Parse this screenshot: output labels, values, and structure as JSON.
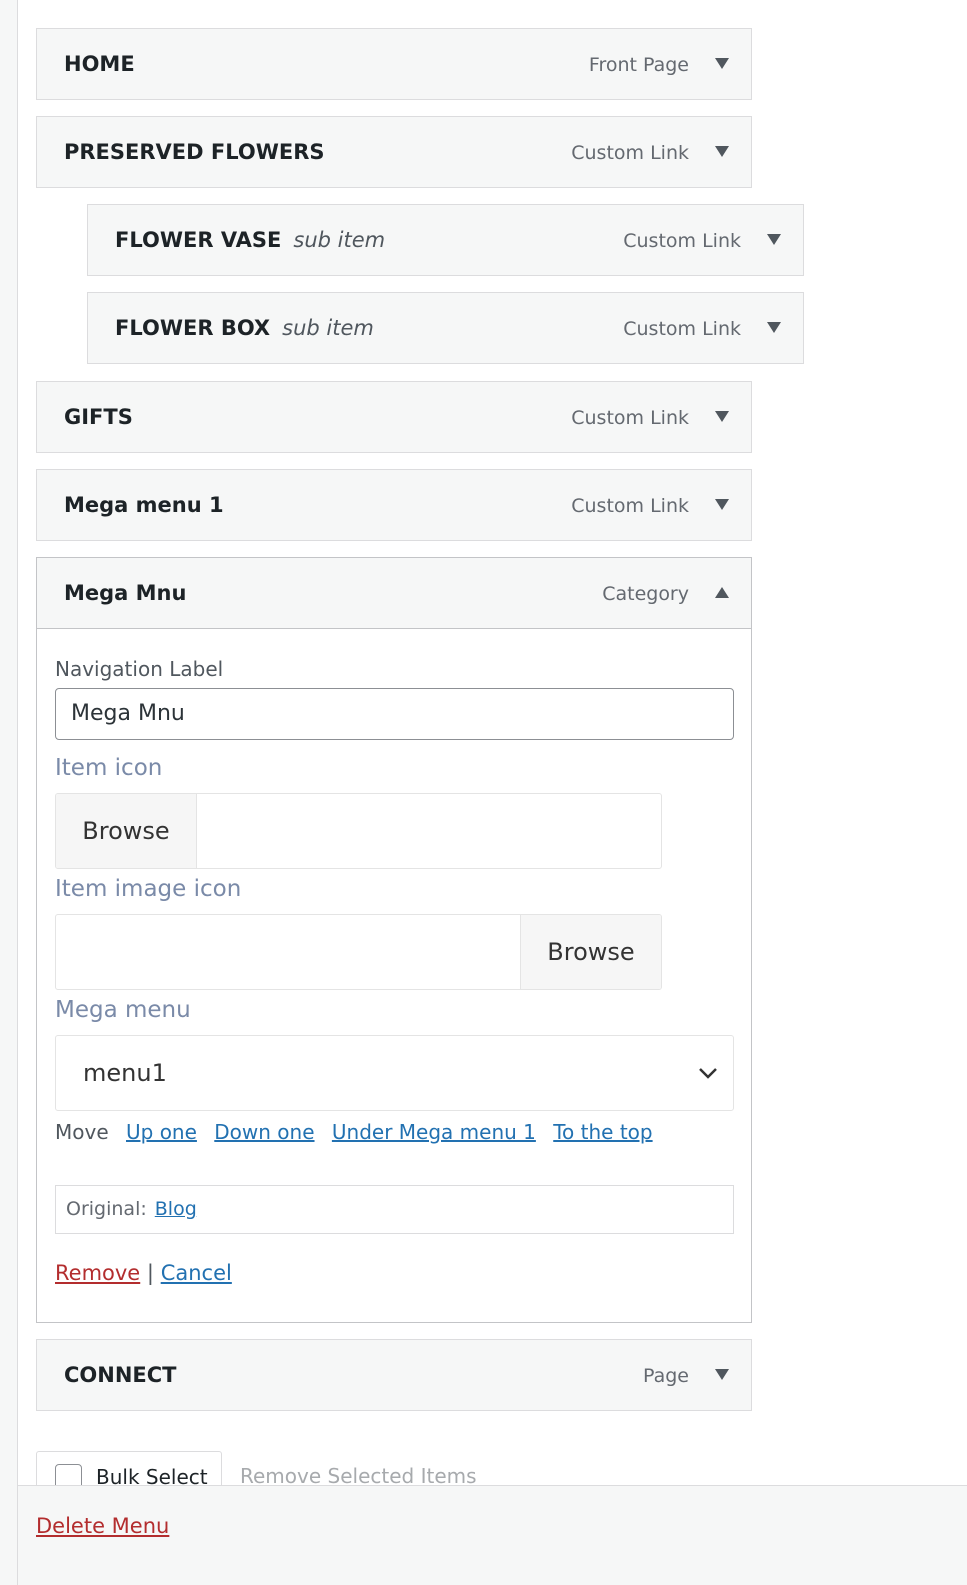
{
  "menu_items": [
    {
      "title": "HOME",
      "sub": "",
      "type": "Front Page"
    },
    {
      "title": "PRESERVED FLOWERS",
      "sub": "",
      "type": "Custom Link"
    },
    {
      "title": "FLOWER VASE",
      "sub": "sub item",
      "type": "Custom Link"
    },
    {
      "title": "FLOWER BOX",
      "sub": "sub item",
      "type": "Custom Link"
    },
    {
      "title": "GIFTS",
      "sub": "",
      "type": "Custom Link"
    },
    {
      "title": "Mega menu 1",
      "sub": "",
      "type": "Custom Link"
    },
    {
      "title": "Mega Mnu",
      "sub": "",
      "type": "Category"
    },
    {
      "title": "CONNECT",
      "sub": "",
      "type": "Page"
    }
  ],
  "settings": {
    "nav_label": "Navigation Label",
    "nav_value": "Mega Mnu",
    "item_icon_label": "Item icon",
    "item_image_icon_label": "Item image icon",
    "browse": "Browse",
    "mega_menu_label": "Mega menu",
    "mega_menu_value": "menu1",
    "move_label": "Move",
    "move_links": [
      "Up one",
      "Down one",
      "Under Mega menu 1",
      "To the top"
    ],
    "original_label": "Original:",
    "original_link": "Blog",
    "remove": "Remove",
    "separator": "|",
    "cancel": "Cancel"
  },
  "bulk": {
    "bulk_select": "Bulk Select",
    "remove_selected": "Remove Selected Items"
  },
  "footer": {
    "delete_menu": "Delete Menu"
  },
  "colors": {
    "link": "#2271b1",
    "danger": "#b32d2e",
    "item_bg": "#f6f7f7",
    "label_blue": "#7a8aa8"
  }
}
